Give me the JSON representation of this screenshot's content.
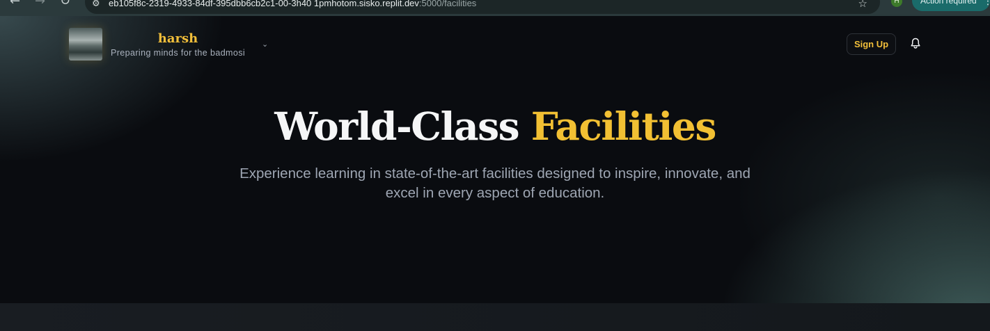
{
  "browser": {
    "url_host": "eb105f8c-2319-4933-84df-395dbb6cb2c1-00-3h40 1pmhotom.sisko.replit.dev",
    "url_path": ":5000/facilities",
    "profile_initial": "H",
    "action_chip_label": "Action required"
  },
  "header": {
    "brand_name": "harsh",
    "brand_tagline": "Preparing minds for the badmosi",
    "signup_label": "Sign Up"
  },
  "hero": {
    "title_main": "World-Class ",
    "title_accent": "Facilities",
    "subtitle": "Experience learning in state-of-the-art facilities designed to inspire, innovate, and excel in every aspect of education."
  },
  "icons": {
    "back": "arrow-left-icon",
    "forward": "arrow-right-icon",
    "reload": "reload-icon",
    "site_info": "site-info-icon",
    "bookmark": "star-icon",
    "menu": "kebab-icon",
    "brand_chevron": "chevron-down-icon",
    "notifications": "bell-icon"
  },
  "colors": {
    "accent": "#f2c033",
    "background": "#0a0c10",
    "text_muted": "#9ea6b3"
  }
}
